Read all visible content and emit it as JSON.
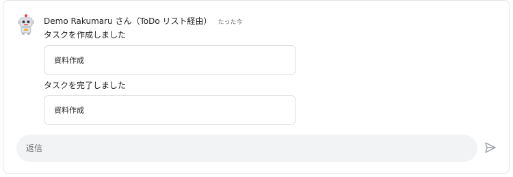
{
  "message": {
    "sender": "Demo Rakumaru さん（ToDo リスト経由）",
    "time": "たった今",
    "events": [
      {
        "text": "タスクを作成しました",
        "task": "資料作成"
      },
      {
        "text": "タスクを完了しました",
        "task": "資料作成"
      }
    ]
  },
  "reply": {
    "placeholder": "返信"
  },
  "icons": {
    "avatar": "robot-avatar-icon",
    "send": "send-icon"
  },
  "colors": {
    "border": "#dadce0",
    "reply_bg": "#f2f3f5",
    "muted": "#6b6b6b"
  }
}
